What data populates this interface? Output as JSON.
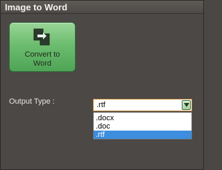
{
  "header": {
    "title": "Image to Word"
  },
  "convert_button": {
    "line1": "Convert to",
    "line2": "Word"
  },
  "output": {
    "label": "Output Type :",
    "selected": ".rtf",
    "options": [
      ".docx",
      ".doc",
      ".rtf"
    ]
  },
  "colors": {
    "accent_green": "#6cbd6f",
    "selection_blue": "#3d8ede",
    "panel_bg": "#4b4845"
  },
  "icons": {
    "convert": "convert-document-icon",
    "dropdown": "chevron-down-icon"
  }
}
